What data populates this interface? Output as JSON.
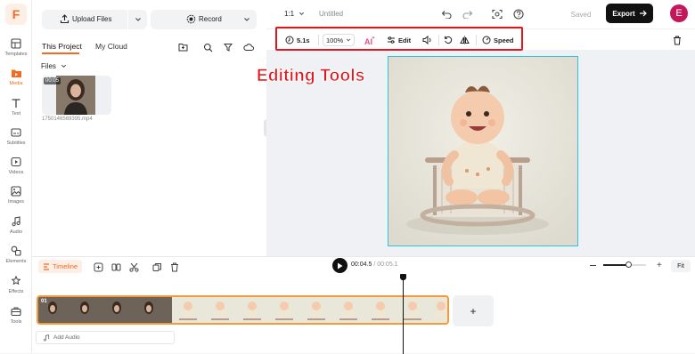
{
  "app": {
    "logo_letter": "F",
    "brand_color": "#f26b21"
  },
  "nav": {
    "items": [
      {
        "label": "Templates",
        "icon": "templates-icon"
      },
      {
        "label": "Media",
        "icon": "media-icon",
        "active": true
      },
      {
        "label": "Text",
        "icon": "text-icon"
      },
      {
        "label": "Subtitles",
        "icon": "subtitles-icon"
      },
      {
        "label": "Videos",
        "icon": "videos-icon"
      },
      {
        "label": "Images",
        "icon": "images-icon"
      },
      {
        "label": "Audio",
        "icon": "audio-icon"
      },
      {
        "label": "Elements",
        "icon": "elements-icon"
      },
      {
        "label": "Effects",
        "icon": "effects-icon"
      },
      {
        "label": "Tools",
        "icon": "tools-icon"
      }
    ]
  },
  "media": {
    "upload_label": "Upload Files",
    "record_label": "Record",
    "tabs": [
      "This Project",
      "My Cloud"
    ],
    "files_label": "Files",
    "file": {
      "duration": "00:05",
      "name": "1750146569395.mp4"
    }
  },
  "topbar": {
    "aspect": "1:1",
    "title": "Untitled",
    "saved_label": "Saved",
    "export_label": "Export",
    "avatar_letter": "E",
    "avatar_color": "#c2185b"
  },
  "toolbar": {
    "duration": "5.1s",
    "zoom": "100%",
    "edit_label": "Edit",
    "speed_label": "Speed"
  },
  "annotation": {
    "text": "Editing Tools",
    "color": "#e0171f"
  },
  "timeline": {
    "label": "Timeline",
    "current_time": "00:04.5",
    "total_time": "00:05.1",
    "fit_label": "Fit",
    "track_index": "01",
    "add_audio_label": "Add Audio",
    "add_clip_symbol": "+"
  }
}
